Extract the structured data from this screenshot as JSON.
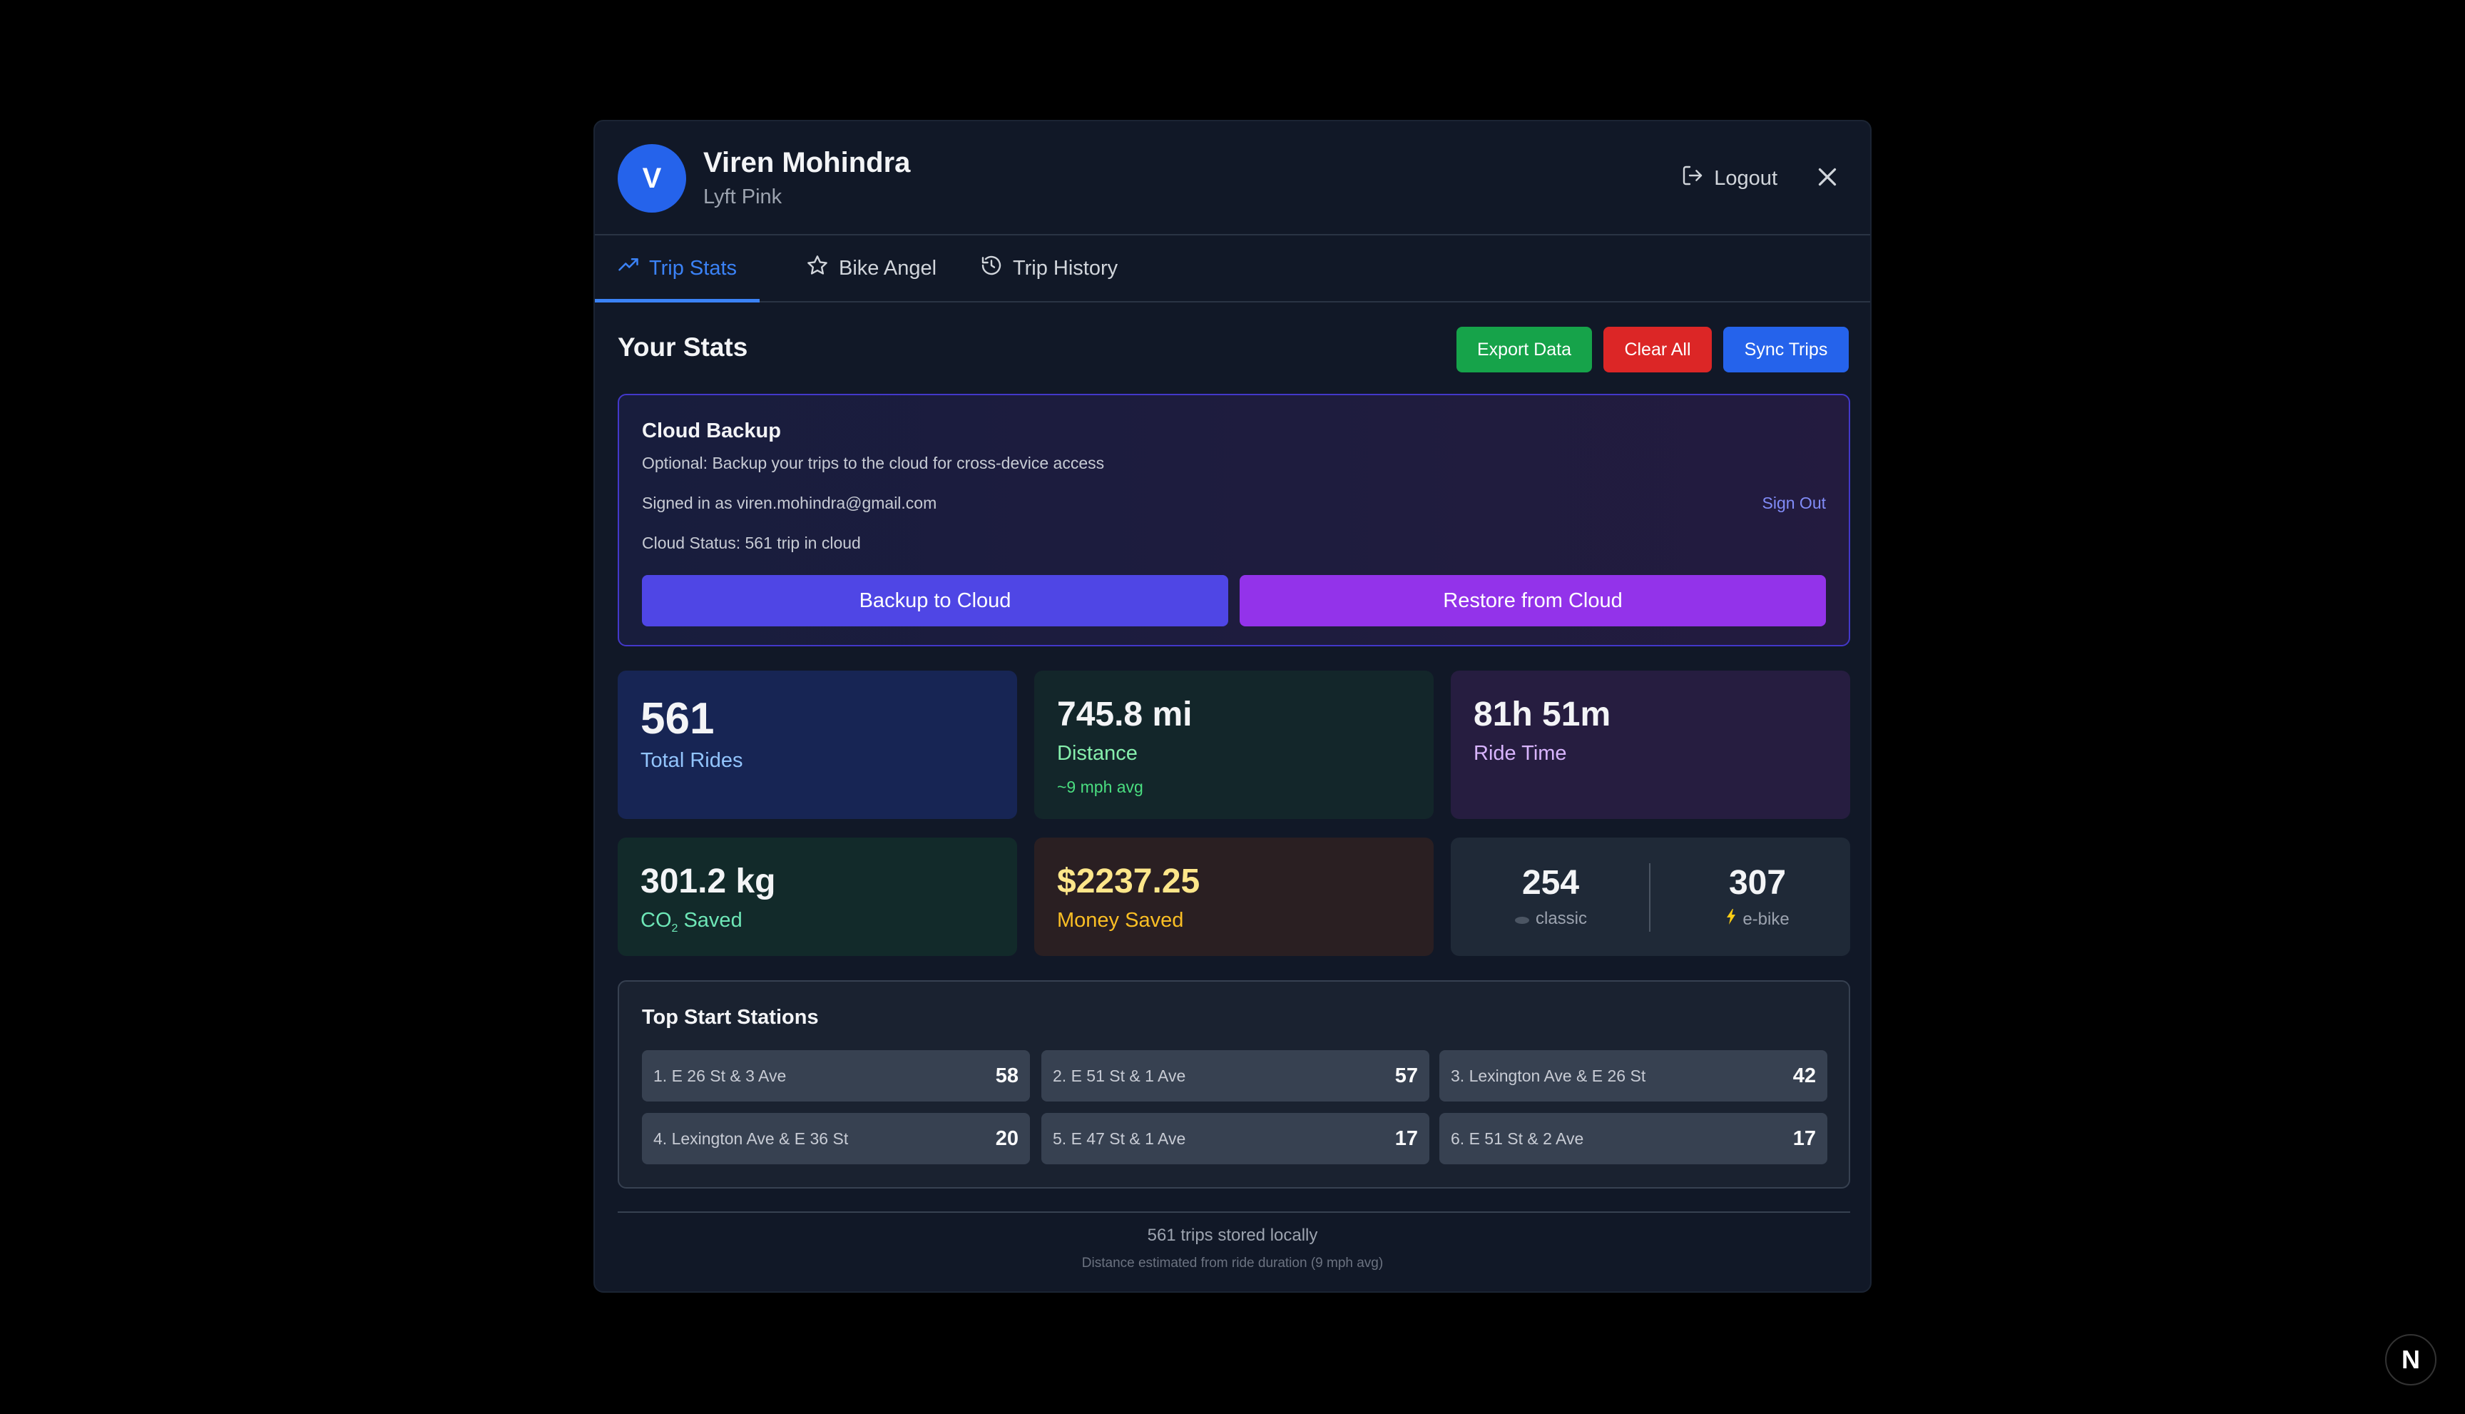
{
  "header": {
    "avatar_initial": "V",
    "name": "Viren Mohindra",
    "tier": "Lyft Pink",
    "logout_label": "Logout"
  },
  "tabs": [
    {
      "label": "Trip Stats",
      "icon": "trending-up-icon",
      "active": true
    },
    {
      "label": "Bike Angel",
      "icon": "star-icon",
      "active": false
    },
    {
      "label": "Trip History",
      "icon": "history-icon",
      "active": false
    }
  ],
  "stats_section": {
    "title": "Your Stats",
    "export_label": "Export Data",
    "clear_label": "Clear All",
    "sync_label": "Sync Trips"
  },
  "cloud": {
    "title": "Cloud Backup",
    "description": "Optional: Backup your trips to the cloud for cross-device access",
    "signed_in": "Signed in as viren.mohindra@gmail.com",
    "sign_out": "Sign Out",
    "status": "Cloud Status: 561 trip in cloud",
    "backup_label": "Backup to Cloud",
    "restore_label": "Restore from Cloud"
  },
  "cards": {
    "rides": {
      "value": "561",
      "label": "Total Rides"
    },
    "distance": {
      "value": "745.8 mi",
      "label": "Distance",
      "sub": "~9 mph avg"
    },
    "time": {
      "value": "81h 51m",
      "label": "Ride Time"
    },
    "co2": {
      "value": "301.2 kg",
      "label_prefix": "CO",
      "label_sub": "2",
      "label_suffix": " Saved"
    },
    "money": {
      "value": "$2237.25",
      "label": "Money Saved"
    },
    "bikes": {
      "classic_count": "254",
      "classic_label": "classic",
      "classic_icon": "bike-icon",
      "ebike_count": "307",
      "ebike_label": "e-bike",
      "ebike_icon": "lightning-icon"
    }
  },
  "stations": {
    "title": "Top Start Stations",
    "items": [
      {
        "name": "1. E 26 St & 3 Ave",
        "count": "58"
      },
      {
        "name": "2. E 51 St & 1 Ave",
        "count": "57"
      },
      {
        "name": "3. Lexington Ave & E 26 St",
        "count": "42"
      },
      {
        "name": "4. Lexington Ave & E 36 St",
        "count": "20"
      },
      {
        "name": "5. E 47 St & 1 Ave",
        "count": "17"
      },
      {
        "name": "6. E 51 St & 2 Ave",
        "count": "17"
      }
    ]
  },
  "footer": {
    "line1": "561 trips stored locally",
    "line2": "Distance estimated from ride duration (9 mph avg)"
  },
  "badge": {
    "letter": "N"
  },
  "colors": {
    "accent": "#3b82f6",
    "export": "#16a34a",
    "clear": "#dc2626",
    "sync": "#2563eb",
    "backup": "#4f46e5",
    "restore": "#9333ea"
  }
}
